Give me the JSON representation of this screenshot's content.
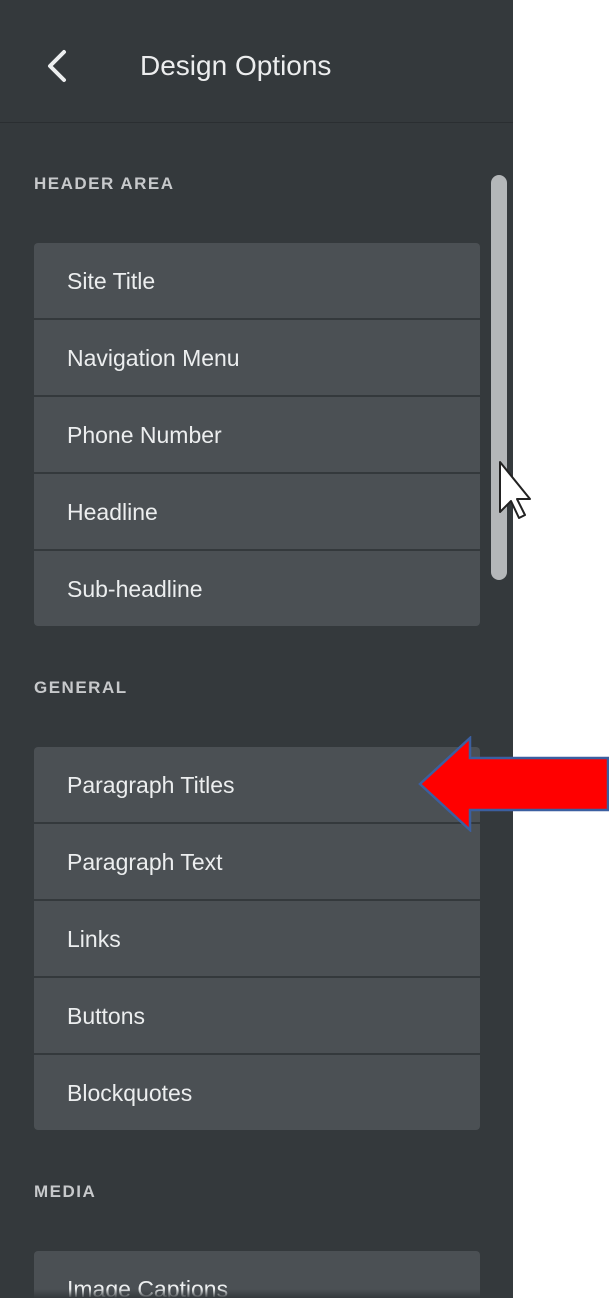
{
  "header": {
    "back_icon": "chevron-left-icon",
    "title": "Design Options"
  },
  "sections": [
    {
      "label": "HEADER AREA",
      "items": [
        "Site Title",
        "Navigation Menu",
        "Phone Number",
        "Headline",
        "Sub-headline"
      ]
    },
    {
      "label": "GENERAL",
      "items": [
        "Paragraph Titles",
        "Paragraph Text",
        "Links",
        "Buttons",
        "Blockquotes"
      ]
    },
    {
      "label": "MEDIA",
      "items": [
        "Image Captions"
      ]
    }
  ],
  "annotation": {
    "arrow_color": "#ff0000",
    "arrow_outline": "#3b5fa0",
    "points_to": "Paragraph Titles"
  },
  "colors": {
    "panel_bg": "#34393c",
    "item_bg": "#4b5054",
    "text": "#eceeef",
    "section_label": "#c7c9cb"
  }
}
